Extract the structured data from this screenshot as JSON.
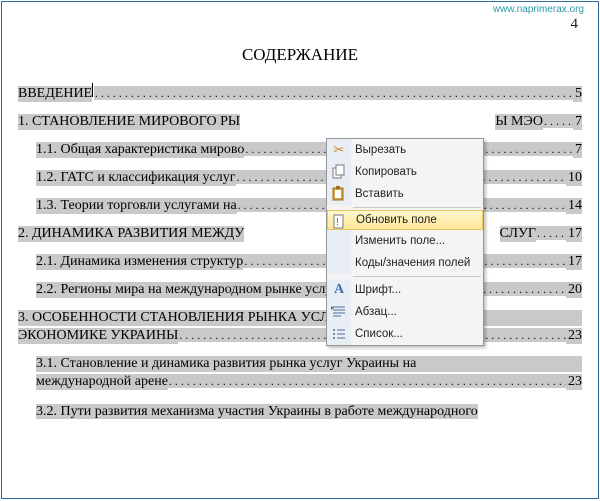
{
  "watermark": "www.naprimerax.org",
  "page_number": "4",
  "title": "СОДЕРЖАНИЕ",
  "toc": {
    "row0": {
      "label": "ВВЕДЕНИЕ",
      "page": "5"
    },
    "row1": {
      "label": "1. СТАНОВЛЕНИЕ МИРОВОГО РЫ",
      "tail": "Ы МЭО",
      "page": "7"
    },
    "row2": {
      "label": "1.1. Общая характеристика мирово",
      "page": "7"
    },
    "row3": {
      "label": "1.2. ГАТС и классификация услуг",
      "page": "10"
    },
    "row4": {
      "label": "1.3. Теории торговли услугами на",
      "page": "14"
    },
    "row5": {
      "label": "2. ДИНАМИКА РАЗВИТИЯ МЕЖДУ",
      "tail": "СЛУГ",
      "page": "17"
    },
    "row6": {
      "label": "2.1. Динамика изменения структур",
      "page": "17"
    },
    "row7": {
      "label": "2.2. Регионы мира на международном рынке услуг",
      "page": "20"
    },
    "row8a": "3. ОСОБЕННОСТИ СТАНОВЛЕНИЯ РЫНКА УСЛУГ ВО ВНЕШНЕЙ",
    "row8b": {
      "label": "ЭКОНОМИКЕ УКРАИНЫ",
      "page": "23"
    },
    "row9a": "3.1. Становление и динамика развития рынка услуг Украины на",
    "row9b": {
      "label": "международной арене",
      "page": "23"
    },
    "row10": "3.2. Пути развития механизма участия Украины в работе международного"
  },
  "dots": "............................................................................................................",
  "context_menu": {
    "cut": "Вырезать",
    "copy": "Копировать",
    "paste": "Вставить",
    "update_field": "Обновить поле",
    "edit_field": "Изменить поле...",
    "field_codes": "Коды/значения полей",
    "font": "Шрифт...",
    "paragraph": "Абзац...",
    "list": "Список..."
  }
}
